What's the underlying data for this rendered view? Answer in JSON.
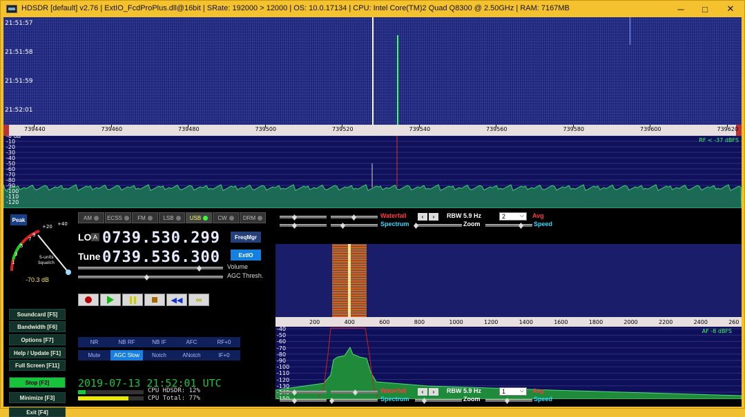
{
  "window": {
    "title": "HDSDR  [default]  v2.76   |  ExtIO_FcdProPlus.dll@16bit  |  SRate: 192000 > 12000  |  OS: 10.0.17134   |  CPU: Intel Core(TM)2 Quad     Q8300  @ 2.50GHz  |  RAM: 7167MB",
    "min": "─",
    "max": "□",
    "close": "✕"
  },
  "waterfall": {
    "times": [
      "21:51:57",
      "21:51:58",
      "21:51:59",
      "21:52:01"
    ]
  },
  "freq_axis": [
    "739440",
    "739460",
    "739480",
    "739500",
    "739520",
    "739540",
    "739560",
    "739580",
    "739600",
    "739620"
  ],
  "rf_spectrum": {
    "db_labels": [
      "-0 dB",
      "-10",
      "-20",
      "-30",
      "-40",
      "-50",
      "-60",
      "-70",
      "-80",
      "-90",
      "-100",
      "-110",
      "-120"
    ],
    "level": "RF < -37 dBFS"
  },
  "smeter": {
    "peak": "Peak",
    "scale": [
      "1",
      "3",
      "5",
      "7",
      "9",
      "+20",
      "+40"
    ],
    "sublabel1": "S-units",
    "sublabel2": "Squelch",
    "db": "-70.3 dB"
  },
  "modes": [
    {
      "label": "AM"
    },
    {
      "label": "ECSS"
    },
    {
      "label": "FM"
    },
    {
      "label": "LSB"
    },
    {
      "label": "USB"
    },
    {
      "label": "CW"
    },
    {
      "label": "DRM"
    }
  ],
  "active_mode": "USB",
  "lo": {
    "label": "LO",
    "a": "A",
    "value": "0739.530.299"
  },
  "tune": {
    "label": "Tune",
    "value": "0739.536.300"
  },
  "freqmgr": "FreqMgr",
  "extio": "ExtIO",
  "volume": "Volume",
  "agc_thresh": "AGC Thresh.",
  "left_buttons": [
    "Soundcard  [F5]",
    "Bandwidth  [F6]",
    "Options   [F7]",
    "Help / Update  [F1]",
    "Full Screen  [F11]",
    "Stop        [F2]",
    "Minimize  [F3]",
    "Exit        [F4]"
  ],
  "dsp_row1": [
    "NR",
    "NB RF",
    "NB IF",
    "AFC",
    "RF+0"
  ],
  "dsp_row2": [
    "Mute",
    "AGC Slow",
    "Notch",
    "ANotch",
    "IF+0"
  ],
  "clock": "2019-07-13   21:52:01 UTC",
  "cpu": {
    "hdsdr": "CPU HDSDR:  12%",
    "total": "CPU Total:  77%",
    "hdsdr_fraction": 0.12,
    "total_fraction": 0.77
  },
  "top_controls": {
    "waterfall": "Waterfall",
    "rbw": "RBW  5.9 Hz",
    "avg_value": "2",
    "avg": "Avg",
    "spectrum": "Spectrum",
    "zoom": "Zoom",
    "speed": "Speed"
  },
  "bottom_controls": {
    "waterfall": "Waterfall",
    "rbw": "RBW  5.9 Hz",
    "avg_value": "1",
    "avg": "Avg",
    "spectrum": "Spectrum",
    "zoom": "Zoom",
    "speed": "Speed"
  },
  "af_axis": [
    "200",
    "400",
    "600",
    "800",
    "1000",
    "1200",
    "1400",
    "1600",
    "1800",
    "2000",
    "2200",
    "2400",
    "260"
  ],
  "af_spectrum": {
    "db_labels": [
      "-40",
      "-50",
      "-60",
      "-70",
      "-80",
      "-90",
      "-100",
      "-110",
      "-120",
      "-130",
      "-140",
      "-150"
    ],
    "level": "AF  -8 dBFS"
  },
  "colors": {
    "title_bg": "#f3c22e",
    "waterfall": "#1e2679",
    "signal": "#3fff6a",
    "accent": "#1880e0",
    "clock": "#19c63b"
  }
}
